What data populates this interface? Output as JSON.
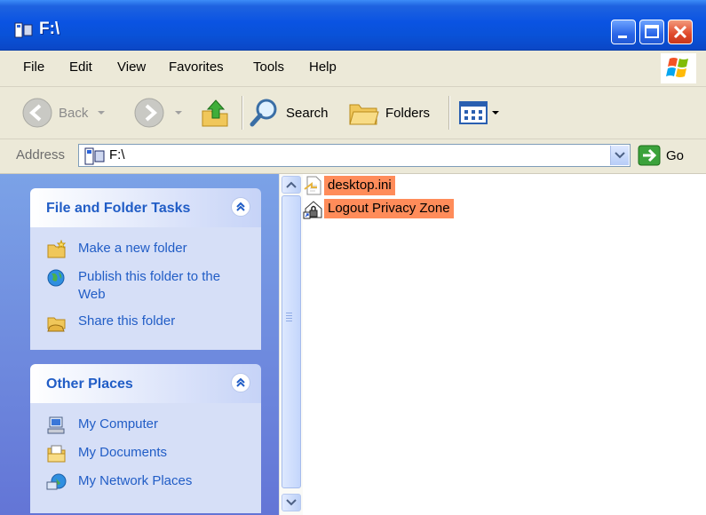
{
  "window": {
    "title": "F:\\"
  },
  "menu": [
    "File",
    "Edit",
    "View",
    "Favorites",
    "Tools",
    "Help"
  ],
  "toolbar": {
    "back": "Back",
    "search": "Search",
    "folders": "Folders"
  },
  "address": {
    "label": "Address",
    "value": "F:\\",
    "go": "Go"
  },
  "file_folder_tasks": {
    "title": "File and Folder Tasks",
    "items": [
      {
        "label": "Make a new folder",
        "icon": "new-folder-icon"
      },
      {
        "label": "Publish this folder to the Web",
        "icon": "globe-icon"
      },
      {
        "label": "Share this folder",
        "icon": "share-folder-icon"
      }
    ]
  },
  "other_places": {
    "title": "Other Places",
    "items": [
      {
        "label": "My Computer",
        "icon": "computer-icon"
      },
      {
        "label": "My Documents",
        "icon": "documents-icon"
      },
      {
        "label": "My Network Places",
        "icon": "network-icon"
      }
    ]
  },
  "files": [
    {
      "name": "desktop.ini",
      "icon": "ini-file-icon",
      "selected": true
    },
    {
      "name": "Logout Privacy Zone",
      "icon": "lock-shortcut-icon",
      "selected": true
    }
  ],
  "colors": {
    "titlebar": "#0a53e2",
    "selection": "#ff8c5a",
    "task_link": "#215dc6",
    "taskpane": "#6f8fe0"
  }
}
